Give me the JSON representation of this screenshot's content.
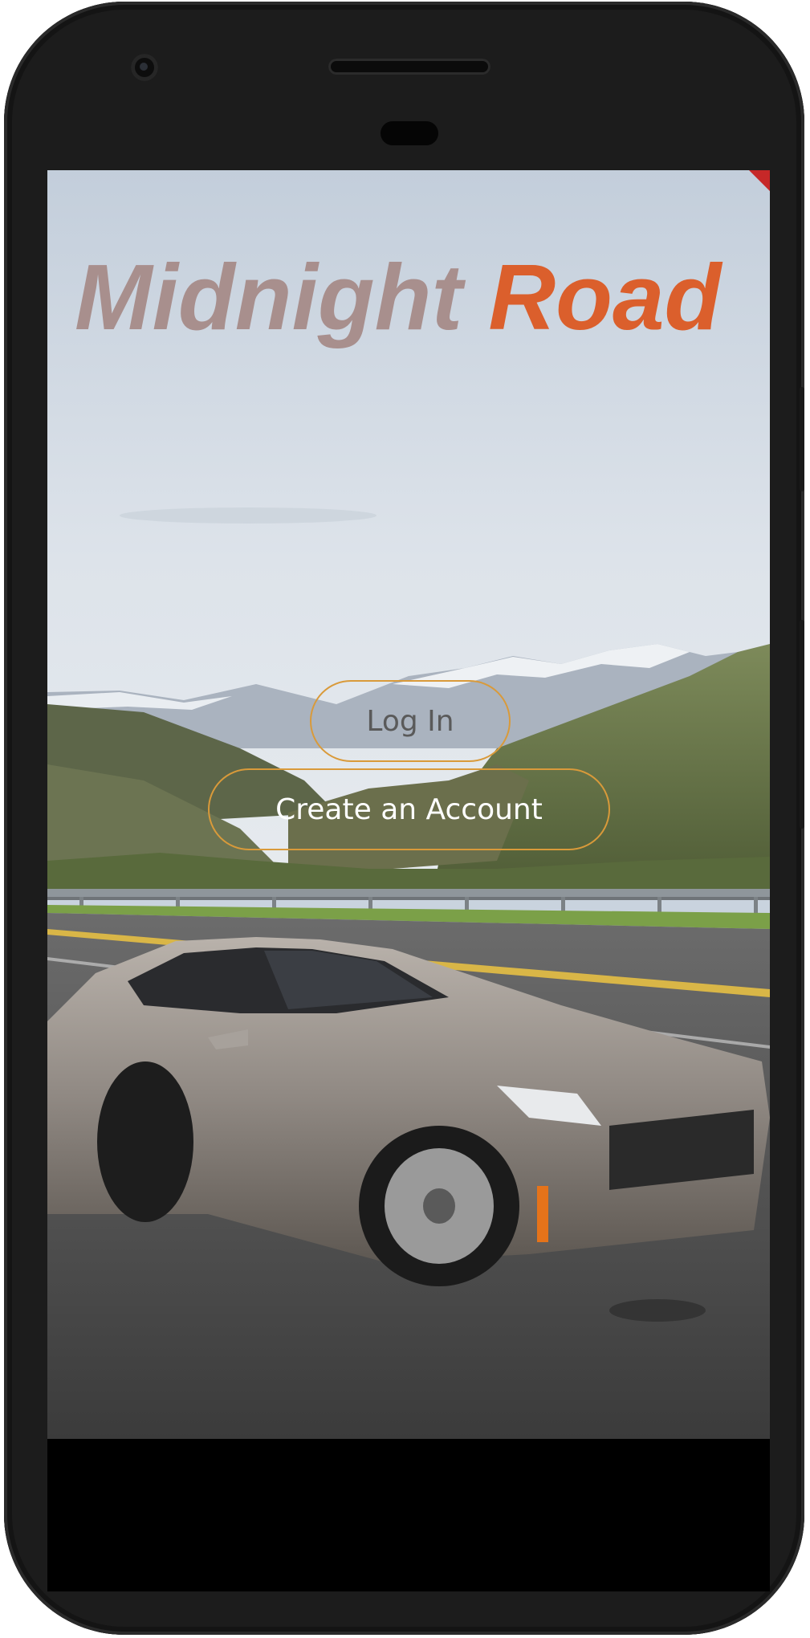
{
  "app": {
    "title_part1": "Midnight",
    "title_part2": "Road"
  },
  "actions": {
    "login_label": "Log In",
    "create_account_label": "Create an Account"
  },
  "colors": {
    "title_part1": "#a88f8d",
    "title_part2": "#db5f2c",
    "button_border": "#d99a3a",
    "login_text": "#5a5a5a",
    "create_text": "#ffffff"
  },
  "background": {
    "description_icon": "car-photo"
  }
}
